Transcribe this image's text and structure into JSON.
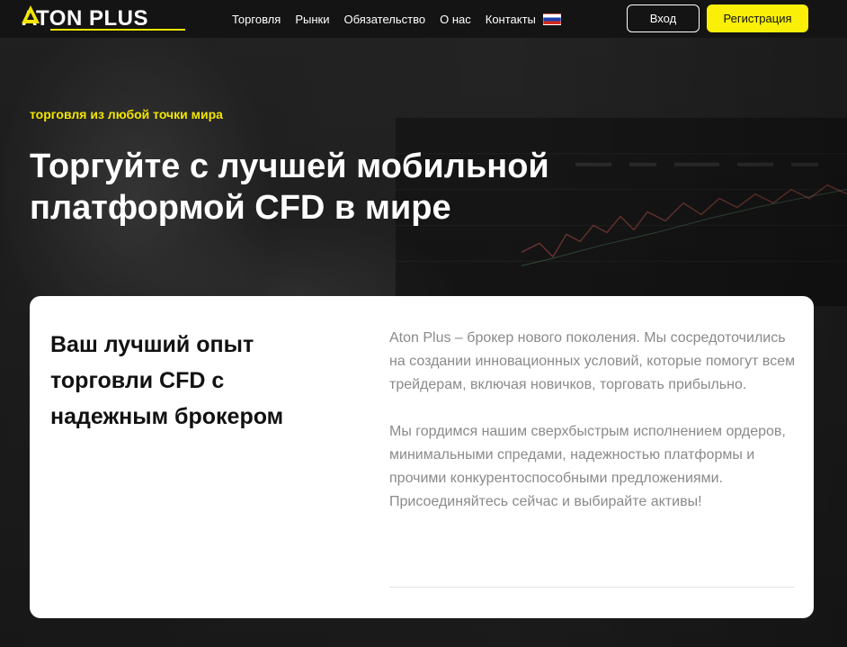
{
  "brand": {
    "logo_text": "ATON PLUS",
    "accent_color": "#f9ef07"
  },
  "nav": {
    "links": [
      {
        "label": "Торговля"
      },
      {
        "label": "Рынки"
      },
      {
        "label": "Обязательство"
      },
      {
        "label": "О нас"
      },
      {
        "label": "Контакты"
      }
    ],
    "language_flag_icon": "russia-flag-icon",
    "login_label": "Вход",
    "register_label": "Регистрация"
  },
  "hero": {
    "eyebrow": "торговля из любой точки мира",
    "title_line1": "Торгуйте с лучшей мобильной",
    "title_line2": "платформой CFD в мире"
  },
  "card": {
    "title_line1": "Ваш лучший опыт",
    "title_line2": "торговли CFD с",
    "title_line3": "надежным брокером",
    "paragraph1": "Aton Plus – брокер нового поколения. Мы сосредоточились на создании инновационных условий, которые помогут всем трейдерам, включая новичков, торговать прибыльно.",
    "paragraph2": "Мы гордимся нашим сверхбыстрым исполнением ордеров, минимальными спредами, надежностью платформы и прочими конкурентоспособными предложениями. Присоединяйтесь сейчас и выбирайте активы!"
  }
}
